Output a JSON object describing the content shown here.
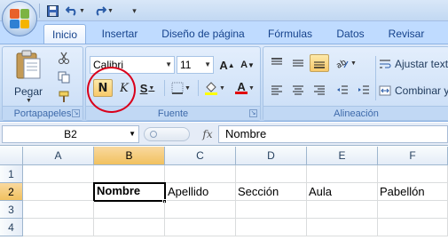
{
  "quick_access": {
    "save_icon": "save-icon",
    "undo_icon": "undo-icon",
    "redo_icon": "redo-icon",
    "customize_icon": "customize-toolbar-icon"
  },
  "tabs": [
    "Inicio",
    "Insertar",
    "Diseño de página",
    "Fórmulas",
    "Datos",
    "Revisar"
  ],
  "ribbon": {
    "portapapeles": {
      "label": "Portapapeles",
      "paste_label": "Pegar"
    },
    "fuente": {
      "label": "Fuente",
      "font_name": "Calibri",
      "font_size": "11",
      "grow_label": "A",
      "shrink_label": "A",
      "bold_label": "N",
      "italic_label": "K",
      "underline_label": "S",
      "font_color_label": "A"
    },
    "alineacion": {
      "label": "Alineación",
      "wrap_label": "Ajustar text",
      "merge_label": "Combinar y"
    }
  },
  "formula_bar": {
    "name_box": "B2",
    "fx_label": "fx",
    "value": "Nombre"
  },
  "sheet": {
    "columns": [
      "A",
      "B",
      "C",
      "D",
      "E",
      "F"
    ],
    "rows": [
      "1",
      "2",
      "3",
      "4"
    ],
    "cells_row2": [
      "",
      "Nombre",
      "Apellido",
      "Sección",
      "Aula",
      "Pabellón"
    ]
  },
  "colors": {
    "accent_highlight": "#f8c96a",
    "annotation_circle": "#d9001b"
  }
}
